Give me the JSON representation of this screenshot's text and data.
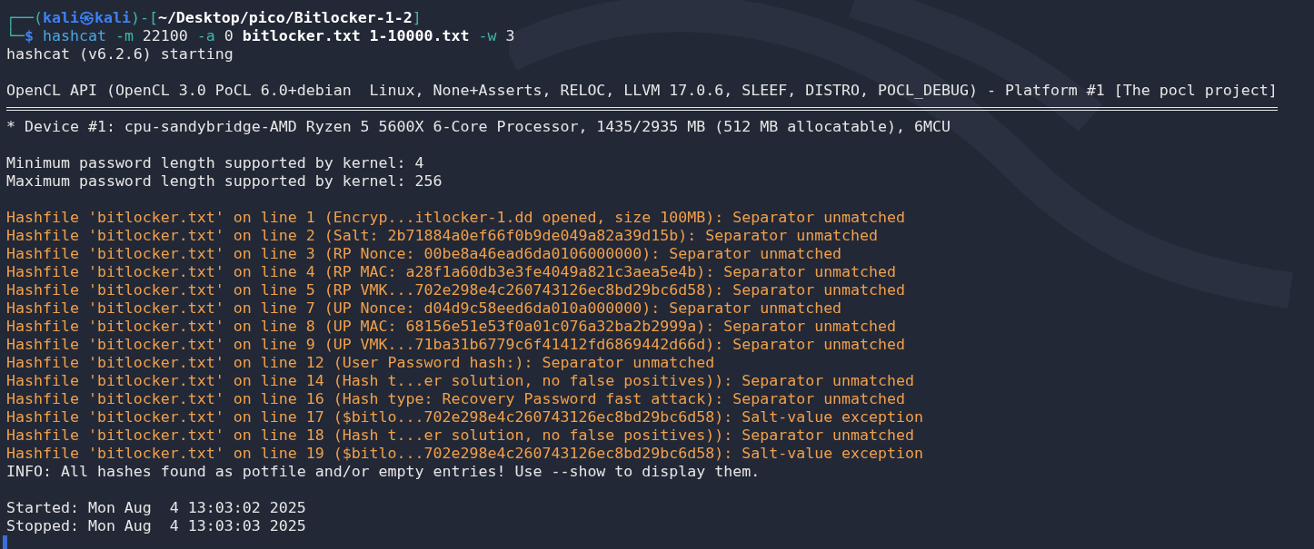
{
  "prompt": {
    "line_1": [
      {
        "text": "┌──(",
        "kind": "frame"
      },
      {
        "text": "kali㉿kali",
        "kind": "user"
      },
      {
        "text": ")-[",
        "kind": "frame"
      },
      {
        "text": "~/Desktop/pico/Bitlocker-1-2",
        "kind": "path"
      },
      {
        "text": "]",
        "kind": "frame"
      }
    ],
    "line_2": [
      {
        "text": "└─",
        "kind": "frame"
      },
      {
        "text": "$",
        "kind": "user"
      }
    ],
    "command": [
      {
        "text": "hashcat",
        "kind": "program"
      },
      {
        "text": "-m",
        "kind": "flag"
      },
      {
        "text": "22100",
        "kind": "arg"
      },
      {
        "text": "-a",
        "kind": "flag"
      },
      {
        "text": "0",
        "kind": "arg"
      },
      {
        "text": "bitlocker.txt",
        "kind": "file"
      },
      {
        "text": "1-10000.txt",
        "kind": "file"
      },
      {
        "text": "-w",
        "kind": "flag"
      },
      {
        "text": "3",
        "kind": "arg"
      }
    ]
  },
  "output": [
    {
      "kind": "plain",
      "text": "hashcat (v6.2.6) starting"
    },
    {
      "kind": "blank"
    },
    {
      "kind": "plain",
      "text": "OpenCL API (OpenCL 3.0 PoCL 6.0+debian  Linux, None+Asserts, RELOC, LLVM 17.0.6, SLEEF, DISTRO, POCL_DEBUG) - Platform #1 [The pocl project]"
    },
    {
      "kind": "rule"
    },
    {
      "kind": "plain",
      "text": "* Device #1: cpu-sandybridge-AMD Ryzen 5 5600X 6-Core Processor, 1435/2935 MB (512 MB allocatable), 6MCU"
    },
    {
      "kind": "blank"
    },
    {
      "kind": "plain",
      "text": "Minimum password length supported by kernel: 4"
    },
    {
      "kind": "plain",
      "text": "Maximum password length supported by kernel: 256"
    },
    {
      "kind": "blank"
    },
    {
      "kind": "warning",
      "text": "Hashfile 'bitlocker.txt' on line 1 (Encryp...itlocker-1.dd opened, size 100MB): Separator unmatched"
    },
    {
      "kind": "warning",
      "text": "Hashfile 'bitlocker.txt' on line 2 (Salt: 2b71884a0ef66f0b9de049a82a39d15b): Separator unmatched"
    },
    {
      "kind": "warning",
      "text": "Hashfile 'bitlocker.txt' on line 3 (RP Nonce: 00be8a46ead6da0106000000): Separator unmatched"
    },
    {
      "kind": "warning",
      "text": "Hashfile 'bitlocker.txt' on line 4 (RP MAC: a28f1a60db3e3fe4049a821c3aea5e4b): Separator unmatched"
    },
    {
      "kind": "warning",
      "text": "Hashfile 'bitlocker.txt' on line 5 (RP VMK...702e298e4c260743126ec8bd29bc6d58): Separator unmatched"
    },
    {
      "kind": "warning",
      "text": "Hashfile 'bitlocker.txt' on line 7 (UP Nonce: d04d9c58eed6da010a000000): Separator unmatched"
    },
    {
      "kind": "warning",
      "text": "Hashfile 'bitlocker.txt' on line 8 (UP MAC: 68156e51e53f0a01c076a32ba2b2999a): Separator unmatched"
    },
    {
      "kind": "warning",
      "text": "Hashfile 'bitlocker.txt' on line 9 (UP VMK...71ba31b6779c6f41412fd6869442d66d): Separator unmatched"
    },
    {
      "kind": "warning",
      "text": "Hashfile 'bitlocker.txt' on line 12 (User Password hash:): Separator unmatched"
    },
    {
      "kind": "warning",
      "text": "Hashfile 'bitlocker.txt' on line 14 (Hash t...er solution, no false positives)): Separator unmatched"
    },
    {
      "kind": "warning",
      "text": "Hashfile 'bitlocker.txt' on line 16 (Hash type: Recovery Password fast attack): Separator unmatched"
    },
    {
      "kind": "warning",
      "text": "Hashfile 'bitlocker.txt' on line 17 ($bitlo...702e298e4c260743126ec8bd29bc6d58): Salt-value exception"
    },
    {
      "kind": "warning",
      "text": "Hashfile 'bitlocker.txt' on line 18 (Hash t...er solution, no false positives)): Separator unmatched"
    },
    {
      "kind": "warning",
      "text": "Hashfile 'bitlocker.txt' on line 19 ($bitlo...702e298e4c260743126ec8bd29bc6d58): Salt-value exception"
    },
    {
      "kind": "plain",
      "text": "INFO: All hashes found as potfile and/or empty entries! Use --show to display them."
    },
    {
      "kind": "blank"
    },
    {
      "kind": "plain",
      "text": "Started: Mon Aug  4 13:03:02 2025"
    },
    {
      "kind": "plain",
      "text": "Stopped: Mon Aug  4 13:03:03 2025"
    }
  ]
}
